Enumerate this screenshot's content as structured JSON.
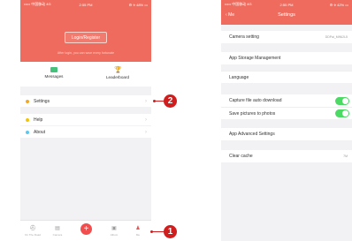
{
  "left_screen": {
    "status": {
      "carrier": "••••• 中国移动 4G",
      "time": "2:55 PM",
      "battery": "⚙ ⟡ 48% ▭"
    },
    "header": {
      "login_button": "Login/Register",
      "tip": "After login, you can save every fortunate"
    },
    "quick_links": [
      {
        "label": "Messages",
        "icon": "message-icon"
      },
      {
        "label": "Leaderboard",
        "icon": "trophy-icon"
      }
    ],
    "menu": [
      {
        "label": "Settings",
        "color": "#f5a623"
      },
      {
        "label": "Help",
        "color": "#f5c400"
      },
      {
        "label": "About",
        "color": "#5cc8f0"
      }
    ],
    "tabs": [
      {
        "label": "On The Road",
        "icon": "road-icon"
      },
      {
        "label": "Camera",
        "icon": "camera-icon"
      },
      {
        "label": "+",
        "icon": "add-icon"
      },
      {
        "label": "Album",
        "icon": "album-icon"
      },
      {
        "label": "Me",
        "icon": "person-icon"
      }
    ],
    "callouts": [
      "1",
      "2"
    ]
  },
  "right_screen": {
    "status": {
      "carrier": "••••• 中国移动 4G",
      "time": "2:55 PM",
      "battery": "⚙ ⟡ 42% ▭"
    },
    "nav": {
      "back": "Me",
      "title": "Settings"
    },
    "rows": [
      {
        "label": "Camera setting",
        "value": "DDPai_MINI2L5"
      },
      {
        "label": "App Storage Management"
      },
      {
        "label": "Language"
      },
      {
        "label": "Capture file auto download",
        "toggle": true
      },
      {
        "label": "Save pictures to photos",
        "toggle": true
      },
      {
        "label": "App Advanced Settings"
      },
      {
        "label": "Clear cache",
        "value": "7M"
      }
    ]
  }
}
